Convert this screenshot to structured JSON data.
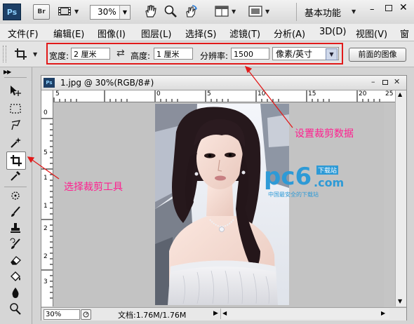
{
  "app": {
    "logo": "Ps",
    "bridge_button": "Br",
    "zoom_value": "30%",
    "workspace": "基本功能"
  },
  "menu": [
    "文件(F)",
    "编辑(E)",
    "图像(I)",
    "图层(L)",
    "选择(S)",
    "滤镜(T)",
    "分析(A)",
    "3D(D)",
    "视图(V)",
    "窗"
  ],
  "options": {
    "width_label": "宽度:",
    "width_value": "2 厘米",
    "height_label": "高度:",
    "height_value": "1 厘米",
    "resolution_label": "分辨率:",
    "resolution_value": "1500",
    "unit_select": "像素/英寸",
    "front_image_button": "前面的图像"
  },
  "document": {
    "title": "1.jpg @ 30%(RGB/8#)",
    "zoom": "30%",
    "doc_info": "文档:1.76M/1.76M",
    "ruler_top_ticks": [
      "5",
      "0",
      "5",
      "10",
      "15",
      "20",
      "25"
    ],
    "ruler_left_ticks": [
      "0",
      "5",
      "1",
      "1",
      "2",
      "2",
      "3"
    ]
  },
  "annotations": {
    "crop_settings": "设置裁剪数据",
    "select_crop_tool": "选择裁剪工具"
  },
  "watermark": {
    "brand": "pc6",
    "suffix": ".com",
    "tag": "下载站",
    "slogan": "中国最安全的下载站"
  },
  "colors": {
    "annotation": "#ff1f8f",
    "highlight_box": "#e11a1a",
    "watermark": "#2e9ad6"
  }
}
